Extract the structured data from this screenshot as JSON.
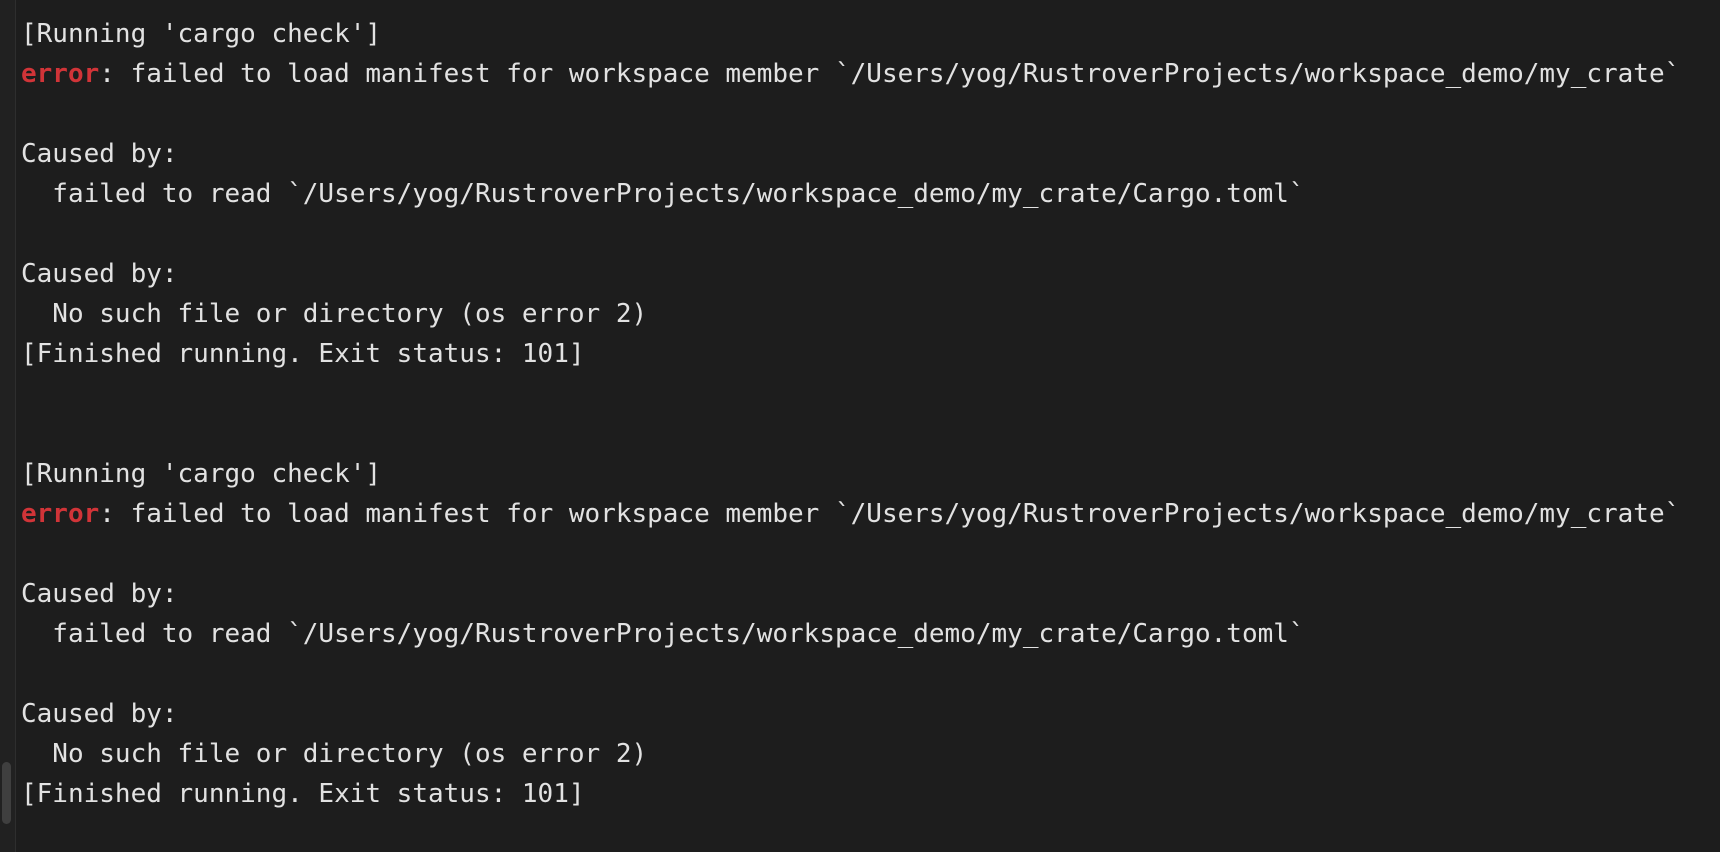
{
  "console": {
    "name": "run-console-output",
    "background_color": "#1d1d1d",
    "gutter_color": "#212121",
    "text_color": "#e2e2e2",
    "error_color": "#d13438",
    "scrollbar_thumb_color": "#4a4a4a",
    "blocks": [
      {
        "name": "run-block-1",
        "lines": [
          {
            "type": "info",
            "text": "[Running 'cargo check']"
          },
          {
            "type": "error",
            "prefix": "error",
            "text": ": failed to load manifest for workspace member `/Users/yog/RustroverProjects/workspace_demo/my_crate`"
          },
          {
            "type": "blank",
            "text": ""
          },
          {
            "type": "plain",
            "text": "Caused by:"
          },
          {
            "type": "plain",
            "text": "  failed to read `/Users/yog/RustroverProjects/workspace_demo/my_crate/Cargo.toml`"
          },
          {
            "type": "blank",
            "text": ""
          },
          {
            "type": "plain",
            "text": "Caused by:"
          },
          {
            "type": "plain",
            "text": "  No such file or directory (os error 2)"
          },
          {
            "type": "info",
            "text": "[Finished running. Exit status: 101]"
          }
        ]
      },
      {
        "name": "run-block-separator",
        "lines": [
          {
            "type": "blank",
            "text": ""
          },
          {
            "type": "blank",
            "text": ""
          }
        ]
      },
      {
        "name": "run-block-2",
        "lines": [
          {
            "type": "info",
            "text": "[Running 'cargo check']"
          },
          {
            "type": "error",
            "prefix": "error",
            "text": ": failed to load manifest for workspace member `/Users/yog/RustroverProjects/workspace_demo/my_crate`"
          },
          {
            "type": "blank",
            "text": ""
          },
          {
            "type": "plain",
            "text": "Caused by:"
          },
          {
            "type": "plain",
            "text": "  failed to read `/Users/yog/RustroverProjects/workspace_demo/my_crate/Cargo.toml`"
          },
          {
            "type": "blank",
            "text": ""
          },
          {
            "type": "plain",
            "text": "Caused by:"
          },
          {
            "type": "plain",
            "text": "  No such file or directory (os error 2)"
          },
          {
            "type": "info",
            "text": "[Finished running. Exit status: 101]"
          }
        ]
      }
    ]
  }
}
